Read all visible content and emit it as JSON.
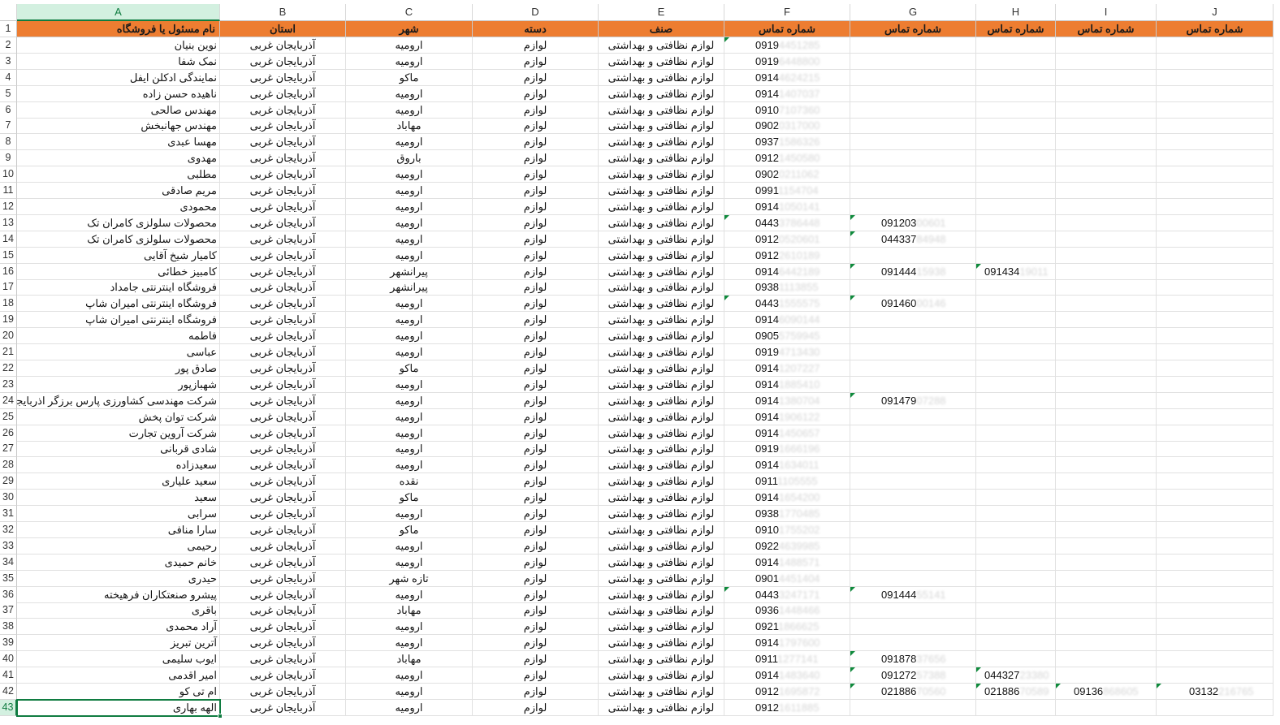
{
  "column_letters": [
    "A",
    "B",
    "C",
    "D",
    "E",
    "F",
    "G",
    "H",
    "I",
    "J"
  ],
  "selected_column": "A",
  "selected_row": 43,
  "header": {
    "row_number": 1,
    "cells": [
      "نام مسئول یا فروشگاه",
      "استان",
      "شهر",
      "دسته",
      "صنف",
      "شماره تماس",
      "شماره تماس",
      "شماره تماس",
      "شماره تماس",
      "شماره تماس"
    ]
  },
  "rows": [
    {
      "n": 2,
      "name": "نوین بنیان",
      "province": "آذربایجان غربی",
      "city": "ارومیه",
      "category": "لوازم",
      "guild": "لوازم نظافتی و بهداشتی",
      "phone1": "0919",
      "phone1_hidden": "4451285"
    },
    {
      "n": 3,
      "name": "نمک شفا",
      "province": "آذربایجان غربی",
      "city": "ارومیه",
      "category": "لوازم",
      "guild": "لوازم نظافتی و بهداشتی",
      "phone1": "0919",
      "phone1_hidden": "6448800"
    },
    {
      "n": 4,
      "name": "نمایندگی ادکلن ایفل",
      "province": "آذربایجان غربی",
      "city": "ماکو",
      "category": "لوازم",
      "guild": "لوازم نظافتی و بهداشتی",
      "phone1": "0914",
      "phone1_hidden": "4624215"
    },
    {
      "n": 5,
      "name": "ناهیده حسن زاده",
      "province": "آذربایجان غربی",
      "city": "ارومیه",
      "category": "لوازم",
      "guild": "لوازم نظافتی و بهداشتی",
      "phone1": "0914",
      "phone1_hidden": "1407037"
    },
    {
      "n": 6,
      "name": "مهندس صالحی",
      "province": "آذربایجان غربی",
      "city": "ارومیه",
      "category": "لوازم",
      "guild": "لوازم نظافتی و بهداشتی",
      "phone1": "0910",
      "phone1_hidden": "7107360"
    },
    {
      "n": 7,
      "name": "مهندس جهانبخش",
      "province": "آذربایجان غربی",
      "city": "مهاباد",
      "category": "لوازم",
      "guild": "لوازم نظافتی و بهداشتی",
      "phone1": "0902",
      "phone1_hidden": "0317000"
    },
    {
      "n": 8,
      "name": "مهسا عبدی",
      "province": "آذربایجان غربی",
      "city": "ارومیه",
      "category": "لوازم",
      "guild": "لوازم نظافتی و بهداشتی",
      "phone1": "0937",
      "phone1_hidden": "1586326"
    },
    {
      "n": 9,
      "name": "مهدوی",
      "province": "آذربایجان غربی",
      "city": "باروق",
      "category": "لوازم",
      "guild": "لوازم نظافتی و بهداشتی",
      "phone1": "0912",
      "phone1_hidden": "1450580"
    },
    {
      "n": 10,
      "name": "مطلبی",
      "province": "آذربایجان غربی",
      "city": "ارومیه",
      "category": "لوازم",
      "guild": "لوازم نظافتی و بهداشتی",
      "phone1": "0902",
      "phone1_hidden": "0211062"
    },
    {
      "n": 11,
      "name": "مریم صادقی",
      "province": "آذربایجان غربی",
      "city": "ارومیه",
      "category": "لوازم",
      "guild": "لوازم نظافتی و بهداشتی",
      "phone1": "0991",
      "phone1_hidden": "1154704"
    },
    {
      "n": 12,
      "name": "محمودی",
      "province": "آذربایجان غربی",
      "city": "ارومیه",
      "category": "لوازم",
      "guild": "لوازم نظافتی و بهداشتی",
      "phone1": "0914",
      "phone1_hidden": "1050141"
    },
    {
      "n": 13,
      "name": "محصولات سلولزی کامران تک",
      "province": "آذربایجان غربی",
      "city": "ارومیه",
      "category": "لوازم",
      "guild": "لوازم نظافتی و بهداشتی",
      "phone1": "0443",
      "phone1_hidden": "3786448",
      "phone2": "091203",
      "phone2_hidden": "00601"
    },
    {
      "n": 14,
      "name": "محصولات سلولزی کامران تک",
      "province": "آذربایجان غربی",
      "city": "ارومیه",
      "category": "لوازم",
      "guild": "لوازم نظافتی و بهداشتی",
      "phone1": "0912",
      "phone1_hidden": "0520601",
      "phone2": "044337",
      "phone2_hidden": "84948"
    },
    {
      "n": 15,
      "name": "کامیار شیخ آقایی",
      "province": "آذربایجان غربی",
      "city": "ارومیه",
      "category": "لوازم",
      "guild": "لوازم نظافتی و بهداشتی",
      "phone1": "0912",
      "phone1_hidden": "2610189"
    },
    {
      "n": 16,
      "name": "کامبیز خطائی",
      "province": "آذربایجان غربی",
      "city": "پیرانشهر",
      "category": "لوازم",
      "guild": "لوازم نظافتی و بهداشتی",
      "phone1": "0914",
      "phone1_hidden": "6442189",
      "phone2": "091444",
      "phone2_hidden": "15938",
      "phone3": "091434",
      "phone3_hidden": "19011"
    },
    {
      "n": 17,
      "name": "فروشگاه اینترنتی جامداد",
      "province": "آذربایجان غربی",
      "city": "پیرانشهر",
      "category": "لوازم",
      "guild": "لوازم نظافتی و بهداشتی",
      "phone1": "0938",
      "phone1_hidden": "1113855"
    },
    {
      "n": 18,
      "name": "فروشگاه اینترنتی امیران شاپ",
      "province": "آذربایجان غربی",
      "city": "ارومیه",
      "category": "لوازم",
      "guild": "لوازم نظافتی و بهداشتی",
      "phone1": "0443",
      "phone1_hidden": "1555575",
      "phone2": "091460",
      "phone2_hidden": "00146"
    },
    {
      "n": 19,
      "name": "فروشگاه اینترنتی امیران شاپ",
      "province": "آذربایجان غربی",
      "city": "ارومیه",
      "category": "لوازم",
      "guild": "لوازم نظافتی و بهداشتی",
      "phone1": "0914",
      "phone1_hidden": "6090144"
    },
    {
      "n": 20,
      "name": "فاطمه",
      "province": "آذربایجان غربی",
      "city": "ارومیه",
      "category": "لوازم",
      "guild": "لوازم نظافتی و بهداشتی",
      "phone1": "0905",
      "phone1_hidden": "5759945"
    },
    {
      "n": 21,
      "name": "عباسی",
      "province": "آذربایجان غربی",
      "city": "ارومیه",
      "category": "لوازم",
      "guild": "لوازم نظافتی و بهداشتی",
      "phone1": "0919",
      "phone1_hidden": "4713430"
    },
    {
      "n": 22,
      "name": "صادق پور",
      "province": "آذربایجان غربی",
      "city": "ماکو",
      "category": "لوازم",
      "guild": "لوازم نظافتی و بهداشتی",
      "phone1": "0914",
      "phone1_hidden": "1207227"
    },
    {
      "n": 23,
      "name": "شهبازپور",
      "province": "آذربایجان غربی",
      "city": "ارومیه",
      "category": "لوازم",
      "guild": "لوازم نظافتی و بهداشتی",
      "phone1": "0914",
      "phone1_hidden": "1885410"
    },
    {
      "n": 24,
      "name": "شرکت مهندسی کشاورزی پارس برزگر اذربایجان",
      "province": "آذربایجان غربی",
      "city": "ارومیه",
      "category": "لوازم",
      "guild": "لوازم نظافتی و بهداشتی",
      "phone1": "0914",
      "phone1_hidden": "1380704",
      "phone2": "091479",
      "phone2_hidden": "07288"
    },
    {
      "n": 25,
      "name": "شرکت توان پخش",
      "province": "آذربایجان غربی",
      "city": "ارومیه",
      "category": "لوازم",
      "guild": "لوازم نظافتی و بهداشتی",
      "phone1": "0914",
      "phone1_hidden": "1906122"
    },
    {
      "n": 26,
      "name": "شرکت آروین تجارت",
      "province": "آذربایجان غربی",
      "city": "ارومیه",
      "category": "لوازم",
      "guild": "لوازم نظافتی و بهداشتی",
      "phone1": "0914",
      "phone1_hidden": "1450657"
    },
    {
      "n": 27,
      "name": "شادی قربانی",
      "province": "آذربایجان غربی",
      "city": "ارومیه",
      "category": "لوازم",
      "guild": "لوازم نظافتی و بهداشتی",
      "phone1": "0919",
      "phone1_hidden": "1666196"
    },
    {
      "n": 28,
      "name": "سعیدزاده",
      "province": "آذربایجان غربی",
      "city": "ارومیه",
      "category": "لوازم",
      "guild": "لوازم نظافتی و بهداشتی",
      "phone1": "0914",
      "phone1_hidden": "1634011"
    },
    {
      "n": 29,
      "name": "سعید علیاری",
      "province": "آذربایجان غربی",
      "city": "نقده",
      "category": "لوازم",
      "guild": "لوازم نظافتی و بهداشتی",
      "phone1": "0911",
      "phone1_hidden": "1105555"
    },
    {
      "n": 30,
      "name": "سعید",
      "province": "آذربایجان غربی",
      "city": "ماکو",
      "category": "لوازم",
      "guild": "لوازم نظافتی و بهداشتی",
      "phone1": "0914",
      "phone1_hidden": "1654200"
    },
    {
      "n": 31,
      "name": "سرابی",
      "province": "آذربایجان غربی",
      "city": "ارومیه",
      "category": "لوازم",
      "guild": "لوازم نظافتی و بهداشتی",
      "phone1": "0938",
      "phone1_hidden": "1770485"
    },
    {
      "n": 32,
      "name": "سارا منافی",
      "province": "آذربایجان غربی",
      "city": "ماکو",
      "category": "لوازم",
      "guild": "لوازم نظافتی و بهداشتی",
      "phone1": "0910",
      "phone1_hidden": "1755202"
    },
    {
      "n": 33,
      "name": "رحیمی",
      "province": "آذربایجان غربی",
      "city": "ارومیه",
      "category": "لوازم",
      "guild": "لوازم نظافتی و بهداشتی",
      "phone1": "0922",
      "phone1_hidden": "4639985"
    },
    {
      "n": 34,
      "name": "خانم حمیدی",
      "province": "آذربایجان غربی",
      "city": "ارومیه",
      "category": "لوازم",
      "guild": "لوازم نظافتی و بهداشتی",
      "phone1": "0914",
      "phone1_hidden": "1488571"
    },
    {
      "n": 35,
      "name": "حیدری",
      "province": "آذربایجان غربی",
      "city": "تازه شهر",
      "category": "لوازم",
      "guild": "لوازم نظافتی و بهداشتی",
      "phone1": "0901",
      "phone1_hidden": "4451404"
    },
    {
      "n": 36,
      "name": "پیشرو صنعتکاران فرهیخته",
      "province": "آذربایجان غربی",
      "city": "ارومیه",
      "category": "لوازم",
      "guild": "لوازم نظافتی و بهداشتی",
      "phone1": "0443",
      "phone1_hidden": "3247171",
      "phone2": "091444",
      "phone2_hidden": "55141"
    },
    {
      "n": 37,
      "name": "باقری",
      "province": "آذربایجان غربی",
      "city": "مهاباد",
      "category": "لوازم",
      "guild": "لوازم نظافتی و بهداشتی",
      "phone1": "0936",
      "phone1_hidden": "1448466"
    },
    {
      "n": 38,
      "name": "آراد محمدی",
      "province": "آذربایجان غربی",
      "city": "ارومیه",
      "category": "لوازم",
      "guild": "لوازم نظافتی و بهداشتی",
      "phone1": "0921",
      "phone1_hidden": "1866625"
    },
    {
      "n": 39,
      "name": "آترین تبریز",
      "province": "آذربایجان غربی",
      "city": "ارومیه",
      "category": "لوازم",
      "guild": "لوازم نظافتی و بهداشتی",
      "phone1": "0914",
      "phone1_hidden": "1797600"
    },
    {
      "n": 40,
      "name": "ایوب سلیمی",
      "province": "آذربایجان غربی",
      "city": "مهاباد",
      "category": "لوازم",
      "guild": "لوازم نظافتی و بهداشتی",
      "phone1": "0911",
      "phone1_hidden": "1277141",
      "phone2": "091878",
      "phone2_hidden": "37656"
    },
    {
      "n": 41,
      "name": "امیر اقدمی",
      "province": "آذربایجان غربی",
      "city": "ارومیه",
      "category": "لوازم",
      "guild": "لوازم نظافتی و بهداشتی",
      "phone1": "0914",
      "phone1_hidden": "1483640",
      "phone2": "091272",
      "phone2_hidden": "57388",
      "phone3": "044327",
      "phone3_hidden": "23380"
    },
    {
      "n": 42,
      "name": "ام تی کو",
      "province": "آذربایجان غربی",
      "city": "ارومیه",
      "category": "لوازم",
      "guild": "لوازم نظافتی و بهداشتی",
      "phone1": "0912",
      "phone1_hidden": "1695872",
      "phone2": "021886",
      "phone2_hidden": "70560",
      "phone3": "021886",
      "phone3_hidden": "70589",
      "phone4": "09136",
      "phone4_hidden": "868605",
      "phone5": "03132",
      "phone5_hidden": "216765"
    },
    {
      "n": 43,
      "name": "الهه بهاری",
      "province": "آذربایجان غربی",
      "city": "ارومیه",
      "category": "لوازم",
      "guild": "لوازم نظافتی و بهداشتی",
      "phone1": "0912",
      "phone1_hidden": "1611885"
    }
  ],
  "colors": {
    "header_fill": "#ed7d31",
    "selection_green": "#107c41",
    "note_marker": "#0f8a3c"
  },
  "icons": {
    "text_number_marker": "green-corner-triangle-icon"
  }
}
